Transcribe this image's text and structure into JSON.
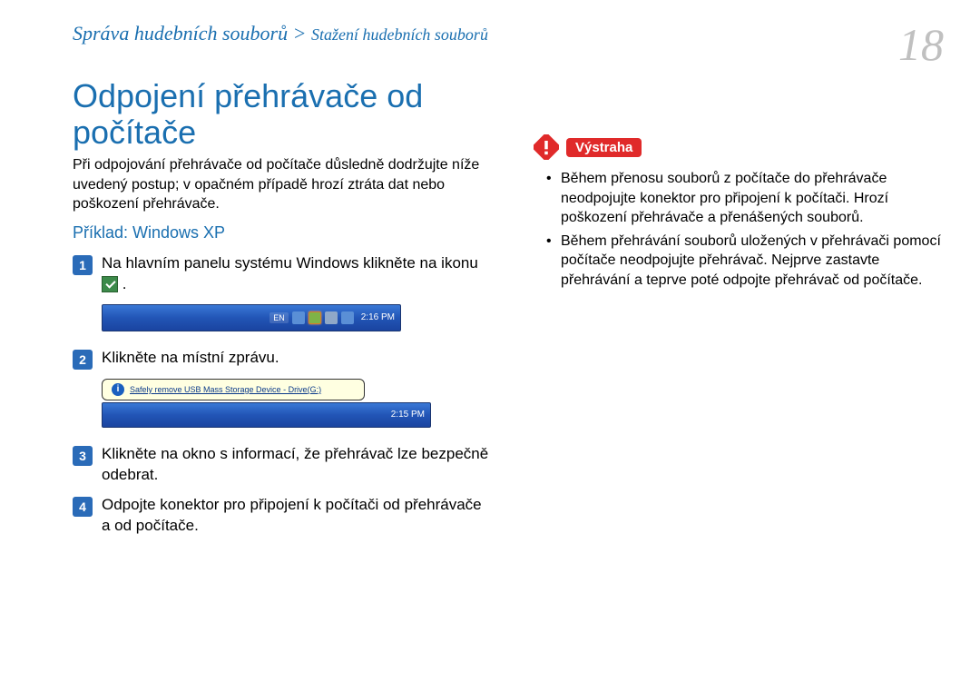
{
  "breadcrumb": {
    "main": "Správa hudebních souborů",
    "separator": " > ",
    "sub": "Stažení hudebních souborů"
  },
  "page_number": "18",
  "title": "Odpojení přehrávače od počítače",
  "intro": "Při odpojování přehrávače od počítače důsledně dodržujte níže uvedený postup; v opačném případě hrozí ztráta dat nebo poškození přehrávače.",
  "example_label": "Příklad: Windows XP",
  "steps": [
    {
      "num": "1",
      "text_before": "Na hlavním panelu systému Windows klikněte na ikonu ",
      "text_after": " ."
    },
    {
      "num": "2",
      "text": "Klikněte na místní zprávu."
    },
    {
      "num": "3",
      "text": "Klikněte na okno s informací, že přehrávač lze bezpečně odebrat."
    },
    {
      "num": "4",
      "text": "Odpojte konektor pro připojení k počítači od přehrávače a od počítače."
    }
  ],
  "taskbar1": {
    "lang": "EN",
    "time": "2:16 PM"
  },
  "balloon": {
    "text": "Safely remove USB Mass Storage Device - Drive(G:)",
    "time": "2:15 PM"
  },
  "warning": {
    "label": "Výstraha",
    "items": [
      "Během přenosu souborů z počítače do přehrávače neodpojujte konektor pro připojení k počítači. Hrozí poškození přehrávače a přenášených souborů.",
      "Během přehrávání souborů uložených v přehrávači pomocí počítače neodpojujte přehrávač. Nejprve zastavte přehrávání a teprve poté odpojte přehrávač od počítače."
    ]
  }
}
